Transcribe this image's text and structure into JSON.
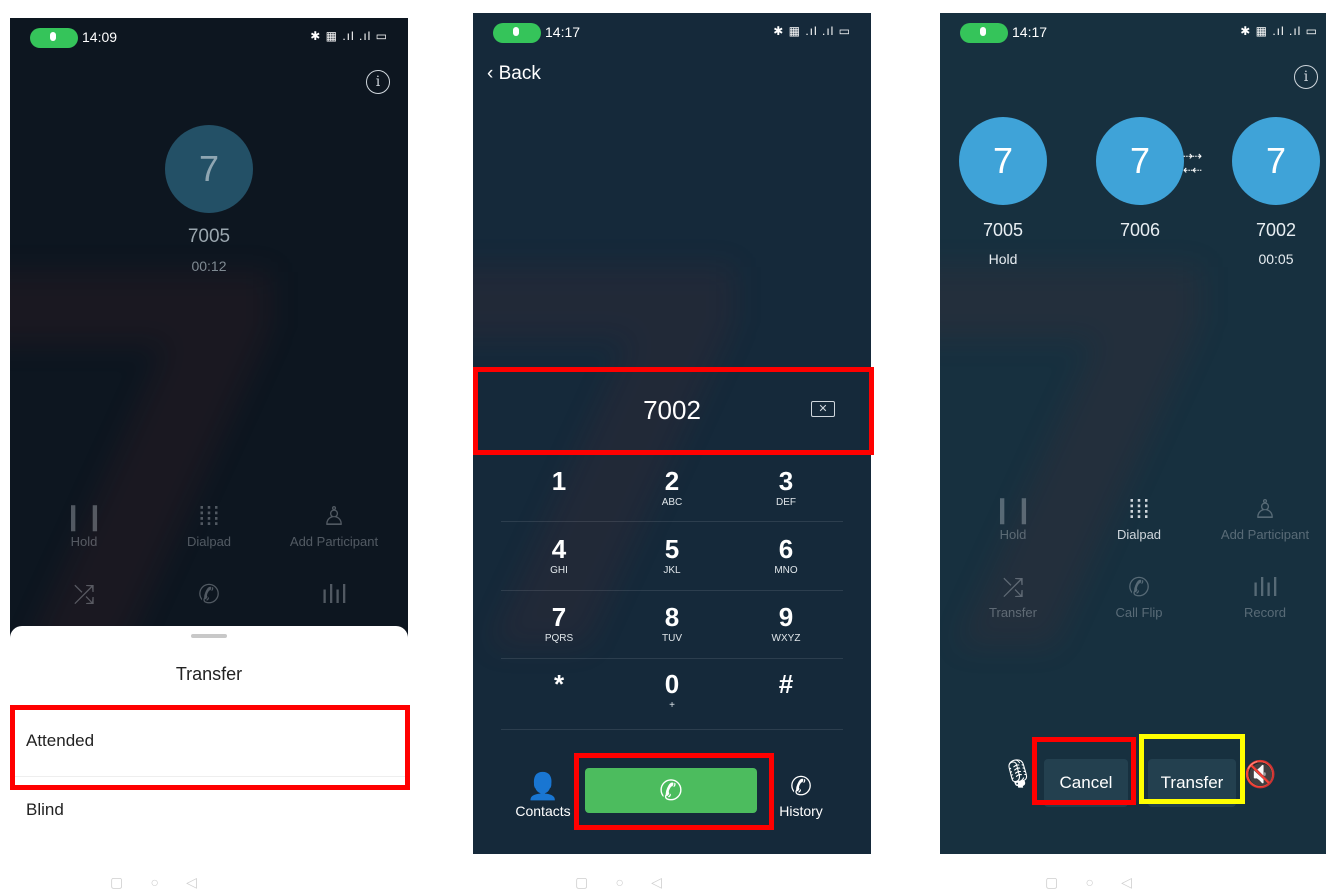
{
  "panel1": {
    "status_time": "14:09",
    "caller_initial": "7",
    "caller_number": "7005",
    "call_duration": "00:12",
    "controls": [
      {
        "label": "Hold",
        "icon": "pause-icon"
      },
      {
        "label": "Dialpad",
        "icon": "dialpad-icon"
      },
      {
        "label": "Add Participant",
        "icon": "add-participant-icon"
      }
    ],
    "sheet": {
      "title": "Transfer",
      "options": [
        "Attended",
        "Blind"
      ]
    }
  },
  "panel2": {
    "status_time": "14:17",
    "back_label": "Back",
    "dialed_number": "7002",
    "keys": [
      {
        "digit": "1",
        "letters": ""
      },
      {
        "digit": "2",
        "letters": "ABC"
      },
      {
        "digit": "3",
        "letters": "DEF"
      },
      {
        "digit": "4",
        "letters": "GHI"
      },
      {
        "digit": "5",
        "letters": "JKL"
      },
      {
        "digit": "6",
        "letters": "MNO"
      },
      {
        "digit": "7",
        "letters": "PQRS"
      },
      {
        "digit": "8",
        "letters": "TUV"
      },
      {
        "digit": "9",
        "letters": "WXYZ"
      },
      {
        "digit": "*",
        "letters": ""
      },
      {
        "digit": "0",
        "letters": "+"
      },
      {
        "digit": "#",
        "letters": ""
      }
    ],
    "contacts_label": "Contacts",
    "history_label": "History"
  },
  "panel3": {
    "status_time": "14:17",
    "participants": [
      {
        "initial": "7",
        "number": "7005",
        "status": "Hold"
      },
      {
        "initial": "7",
        "number": "7006",
        "status": ""
      },
      {
        "initial": "7",
        "number": "7002",
        "status": "00:05"
      }
    ],
    "controls": [
      {
        "label": "Hold",
        "icon": "pause-icon"
      },
      {
        "label": "Dialpad",
        "icon": "dialpad-icon"
      },
      {
        "label": "Add Participant",
        "icon": "add-participant-icon"
      },
      {
        "label": "Transfer",
        "icon": "shuffle-icon"
      },
      {
        "label": "Call Flip",
        "icon": "call-flip-icon"
      },
      {
        "label": "Record",
        "icon": "waveform-icon"
      }
    ],
    "cancel_label": "Cancel",
    "transfer_label": "Transfer"
  },
  "colors": {
    "highlight_red": "#ff0000",
    "highlight_yellow": "#ffff00",
    "call_green": "#4cbc5e",
    "avatar_blue": "#3fa3d8"
  }
}
